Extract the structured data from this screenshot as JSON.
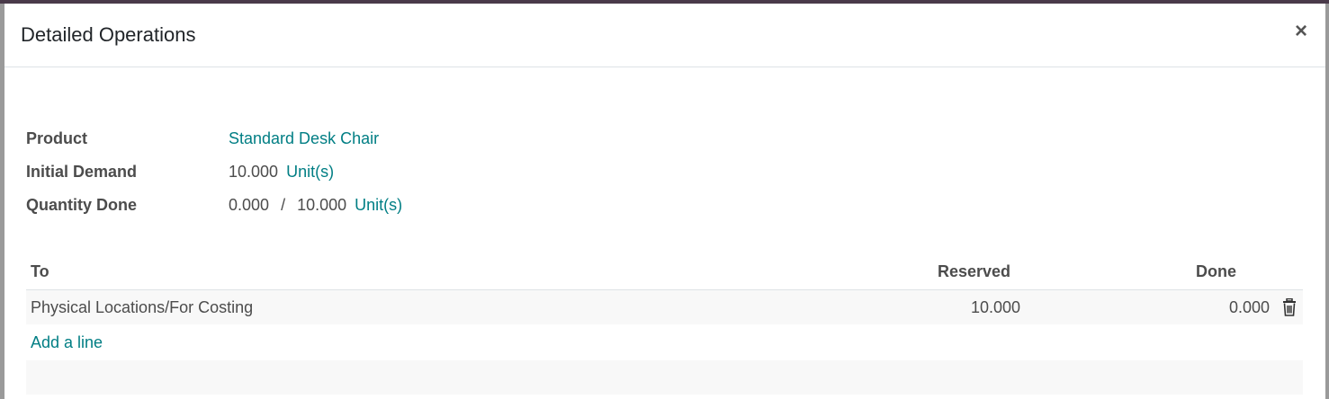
{
  "dialog": {
    "title": "Detailed Operations",
    "close_symbol": "×"
  },
  "fields": {
    "product": {
      "label": "Product",
      "value": "Standard Desk Chair"
    },
    "initial_demand": {
      "label": "Initial Demand",
      "value": "10.000",
      "uom": "Unit(s)"
    },
    "quantity_done": {
      "label": "Quantity Done",
      "done": "0.000",
      "separator": "/",
      "total": "10.000",
      "uom": "Unit(s)"
    }
  },
  "table": {
    "columns": {
      "to": "To",
      "reserved": "Reserved",
      "done": "Done"
    },
    "rows": [
      {
        "to": "Physical Locations/For Costing",
        "reserved": "10.000",
        "done": "0.000"
      }
    ],
    "add_line_label": "Add a line"
  },
  "icons": {
    "close": "close-icon",
    "delete": "trash-icon"
  },
  "colors": {
    "link": "#017e84",
    "text": "#4c4c4c"
  }
}
